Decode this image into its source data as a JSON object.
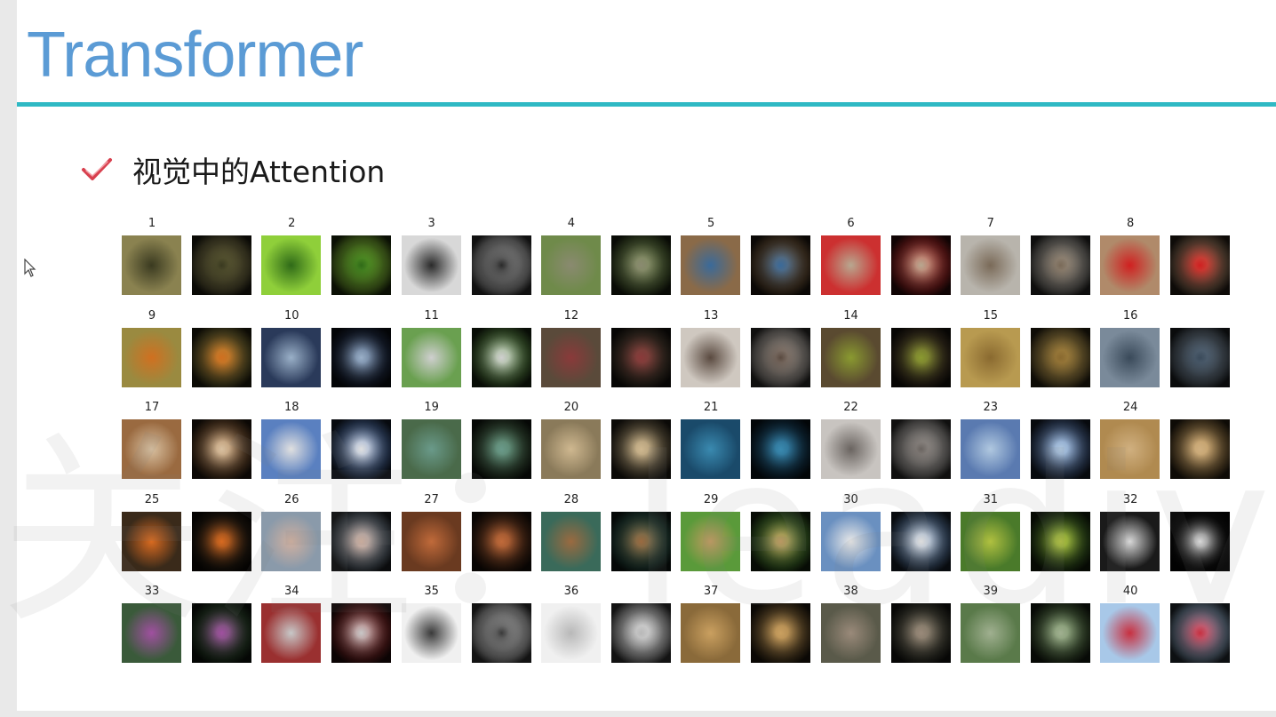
{
  "slide": {
    "title": "Transformer",
    "bullet": "视觉中的Attention",
    "watermark": "关注：leadiv.cn"
  },
  "colors": {
    "title": "#5b9bd5",
    "rule": "#2fb9c4",
    "check": "#d8404e"
  },
  "icons": {
    "check": "check-icon",
    "cursor": "cursor-icon"
  },
  "grid": {
    "pairs": [
      {
        "n": "1",
        "c": [
          "#8a8250",
          "#3a3a20"
        ]
      },
      {
        "n": "2",
        "c": [
          "#8fcf3a",
          "#2f6a18"
        ]
      },
      {
        "n": "3",
        "c": [
          "#d8d8d8",
          "#2a2a2a"
        ]
      },
      {
        "n": "4",
        "c": [
          "#6f8a4a",
          "#8a8a70"
        ]
      },
      {
        "n": "5",
        "c": [
          "#8a6a48",
          "#3a6a9a"
        ]
      },
      {
        "n": "6",
        "c": [
          "#cc3030",
          "#b8a890"
        ]
      },
      {
        "n": "7",
        "c": [
          "#b8b4ac",
          "#7a6a58"
        ]
      },
      {
        "n": "8",
        "c": [
          "#b08a6a",
          "#d02020"
        ]
      },
      {
        "n": "9",
        "c": [
          "#9a8a40",
          "#d07020"
        ]
      },
      {
        "n": "10",
        "c": [
          "#2a3a5a",
          "#9ab0c8"
        ]
      },
      {
        "n": "11",
        "c": [
          "#6aa050",
          "#cfcfcf"
        ]
      },
      {
        "n": "12",
        "c": [
          "#5a4a3a",
          "#8a3a3a"
        ]
      },
      {
        "n": "13",
        "c": [
          "#cfc8c0",
          "#5a4a40"
        ]
      },
      {
        "n": "14",
        "c": [
          "#5a4a30",
          "#8a9a30"
        ]
      },
      {
        "n": "15",
        "c": [
          "#b89a50",
          "#8a6a30"
        ]
      },
      {
        "n": "16",
        "c": [
          "#7a8a9a",
          "#3a4a5a"
        ]
      },
      {
        "n": "17",
        "c": [
          "#9a6a40",
          "#d8c0a0"
        ]
      },
      {
        "n": "18",
        "c": [
          "#5a80c0",
          "#e0e0e0"
        ]
      },
      {
        "n": "19",
        "c": [
          "#4a6a4a",
          "#6a9a8a"
        ]
      },
      {
        "n": "20",
        "c": [
          "#8a7a5a",
          "#cfb890"
        ]
      },
      {
        "n": "21",
        "c": [
          "#1a4a6a",
          "#3a8ab0"
        ]
      },
      {
        "n": "22",
        "c": [
          "#c8c4c0",
          "#6a6460"
        ]
      },
      {
        "n": "23",
        "c": [
          "#5a7ab0",
          "#b0c8e0"
        ]
      },
      {
        "n": "24",
        "c": [
          "#b08a50",
          "#d0b080"
        ]
      },
      {
        "n": "25",
        "c": [
          "#3a2a1a",
          "#d86a20"
        ]
      },
      {
        "n": "26",
        "c": [
          "#8a9aaa",
          "#d0b0a0"
        ]
      },
      {
        "n": "27",
        "c": [
          "#6a3a20",
          "#c06a3a"
        ]
      },
      {
        "n": "28",
        "c": [
          "#3a6a5a",
          "#9a6a40"
        ]
      },
      {
        "n": "29",
        "c": [
          "#5a9a3a",
          "#c09a60"
        ]
      },
      {
        "n": "30",
        "c": [
          "#6a90c0",
          "#e8e8e8"
        ]
      },
      {
        "n": "31",
        "c": [
          "#4a7a2a",
          "#b0c040"
        ]
      },
      {
        "n": "32",
        "c": [
          "#1a1a1a",
          "#d8d8d8"
        ]
      },
      {
        "n": "33",
        "c": [
          "#3a5a3a",
          "#a050a0"
        ]
      },
      {
        "n": "34",
        "c": [
          "#9a3030",
          "#c8c8c8"
        ]
      },
      {
        "n": "35",
        "c": [
          "#f0f0f0",
          "#3a3a3a"
        ]
      },
      {
        "n": "36",
        "c": [
          "#f0f0f0",
          "#b8b8b8"
        ]
      },
      {
        "n": "37",
        "c": [
          "#8a6a3a",
          "#caa060"
        ]
      },
      {
        "n": "38",
        "c": [
          "#5a5a4a",
          "#9a8a7a"
        ]
      },
      {
        "n": "39",
        "c": [
          "#5a7a4a",
          "#a0b090"
        ]
      },
      {
        "n": "40",
        "c": [
          "#a8c8e8",
          "#c83040"
        ]
      }
    ]
  }
}
